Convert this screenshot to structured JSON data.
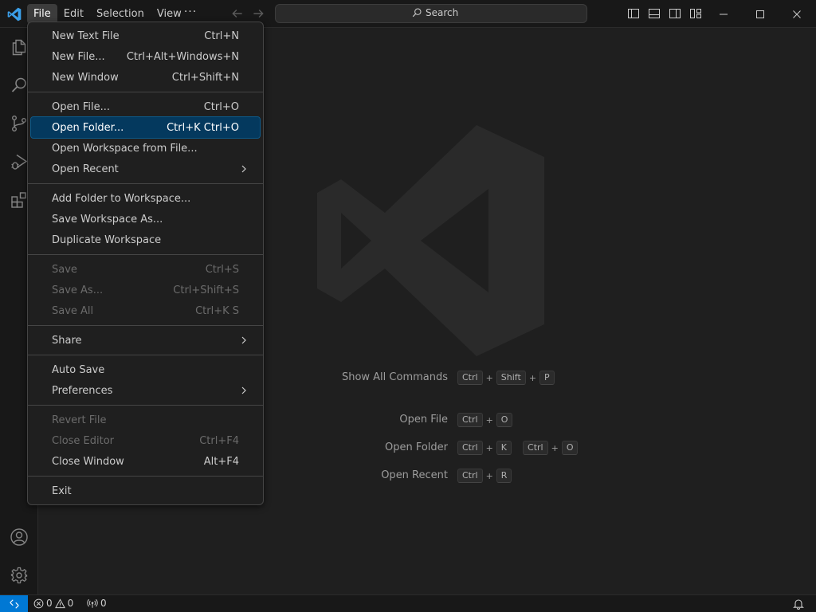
{
  "titlebar": {
    "menus": [
      "File",
      "Edit",
      "Selection",
      "View"
    ],
    "active_menu": "File",
    "more": "···",
    "search_label": "Search"
  },
  "file_menu": {
    "groups": [
      [
        {
          "label": "New Text File",
          "shortcut": "Ctrl+N"
        },
        {
          "label": "New File...",
          "shortcut": "Ctrl+Alt+Windows+N"
        },
        {
          "label": "New Window",
          "shortcut": "Ctrl+Shift+N"
        }
      ],
      [
        {
          "label": "Open File...",
          "shortcut": "Ctrl+O"
        },
        {
          "label": "Open Folder...",
          "shortcut": "Ctrl+K Ctrl+O",
          "selected": true
        },
        {
          "label": "Open Workspace from File...",
          "shortcut": ""
        },
        {
          "label": "Open Recent",
          "shortcut": "",
          "submenu": true
        }
      ],
      [
        {
          "label": "Add Folder to Workspace...",
          "shortcut": ""
        },
        {
          "label": "Save Workspace As...",
          "shortcut": ""
        },
        {
          "label": "Duplicate Workspace",
          "shortcut": ""
        }
      ],
      [
        {
          "label": "Save",
          "shortcut": "Ctrl+S",
          "disabled": true
        },
        {
          "label": "Save As...",
          "shortcut": "Ctrl+Shift+S",
          "disabled": true
        },
        {
          "label": "Save All",
          "shortcut": "Ctrl+K S",
          "disabled": true
        }
      ],
      [
        {
          "label": "Share",
          "shortcut": "",
          "submenu": true
        }
      ],
      [
        {
          "label": "Auto Save",
          "shortcut": ""
        },
        {
          "label": "Preferences",
          "shortcut": "",
          "submenu": true
        }
      ],
      [
        {
          "label": "Revert File",
          "shortcut": "",
          "disabled": true
        },
        {
          "label": "Close Editor",
          "shortcut": "Ctrl+F4",
          "disabled": true
        },
        {
          "label": "Close Window",
          "shortcut": "Alt+F4"
        }
      ],
      [
        {
          "label": "Exit",
          "shortcut": ""
        }
      ]
    ]
  },
  "welcome": {
    "shortcuts": [
      {
        "label": "Show All Commands",
        "keys": [
          [
            "Ctrl",
            "Shift",
            "P"
          ]
        ]
      },
      {
        "label": "Open File",
        "keys": [
          [
            "Ctrl",
            "O"
          ]
        ]
      },
      {
        "label": "Open Folder",
        "keys": [
          [
            "Ctrl",
            "K"
          ],
          [
            "Ctrl",
            "O"
          ]
        ]
      },
      {
        "label": "Open Recent",
        "keys": [
          [
            "Ctrl",
            "R"
          ]
        ]
      }
    ]
  },
  "statusbar": {
    "errors": "0",
    "warnings": "0",
    "ports": "0"
  },
  "colors": {
    "accent": "#0078d4",
    "menu_selected": "#04395e",
    "background": "#1f1f1f",
    "chrome": "#181818"
  }
}
